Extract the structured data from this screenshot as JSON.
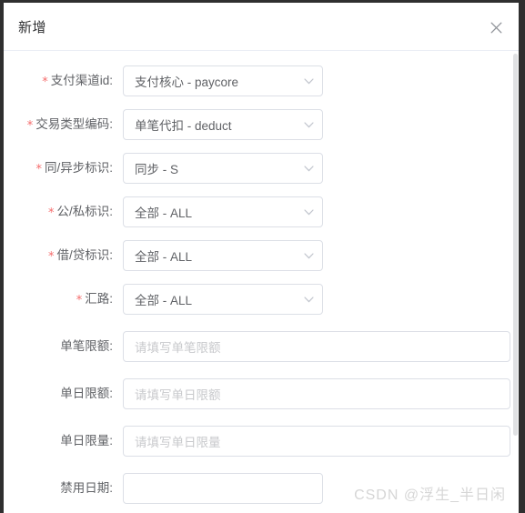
{
  "dialog": {
    "title": "新增",
    "close_icon": "close-icon"
  },
  "form": {
    "fields": [
      {
        "label": "支付渠道id:",
        "required": true,
        "control": "select",
        "value": "支付核心 - paycore",
        "placeholder": ""
      },
      {
        "label": "交易类型编码:",
        "required": true,
        "control": "select",
        "value": "单笔代扣 - deduct",
        "placeholder": ""
      },
      {
        "label": "同/异步标识:",
        "required": true,
        "control": "select",
        "value": "同步 - S",
        "placeholder": ""
      },
      {
        "label": "公/私标识:",
        "required": true,
        "control": "select",
        "value": "全部 - ALL",
        "placeholder": ""
      },
      {
        "label": "借/贷标识:",
        "required": true,
        "control": "select",
        "value": "全部 - ALL",
        "placeholder": ""
      },
      {
        "label": "汇路:",
        "required": true,
        "control": "select",
        "value": "全部 - ALL",
        "placeholder": ""
      },
      {
        "label": "单笔限额:",
        "required": false,
        "control": "input",
        "value": "",
        "placeholder": "请填写单笔限额"
      },
      {
        "label": "单日限额:",
        "required": false,
        "control": "input",
        "value": "",
        "placeholder": "请填写单日限额"
      },
      {
        "label": "单日限量:",
        "required": false,
        "control": "input",
        "value": "",
        "placeholder": "请填写单日限量"
      },
      {
        "label": "禁用日期:",
        "required": false,
        "control": "input-narrow",
        "value": "",
        "placeholder": ""
      }
    ],
    "required_marker": "*"
  },
  "watermark": {
    "text": "CSDN @浮生_半日闲"
  },
  "colors": {
    "required_star": "#f56c6c",
    "label": "#606266",
    "border": "#dcdfe6",
    "placeholder": "#c8c9cc",
    "title": "#303133",
    "backdrop": "#2f2f2f"
  }
}
